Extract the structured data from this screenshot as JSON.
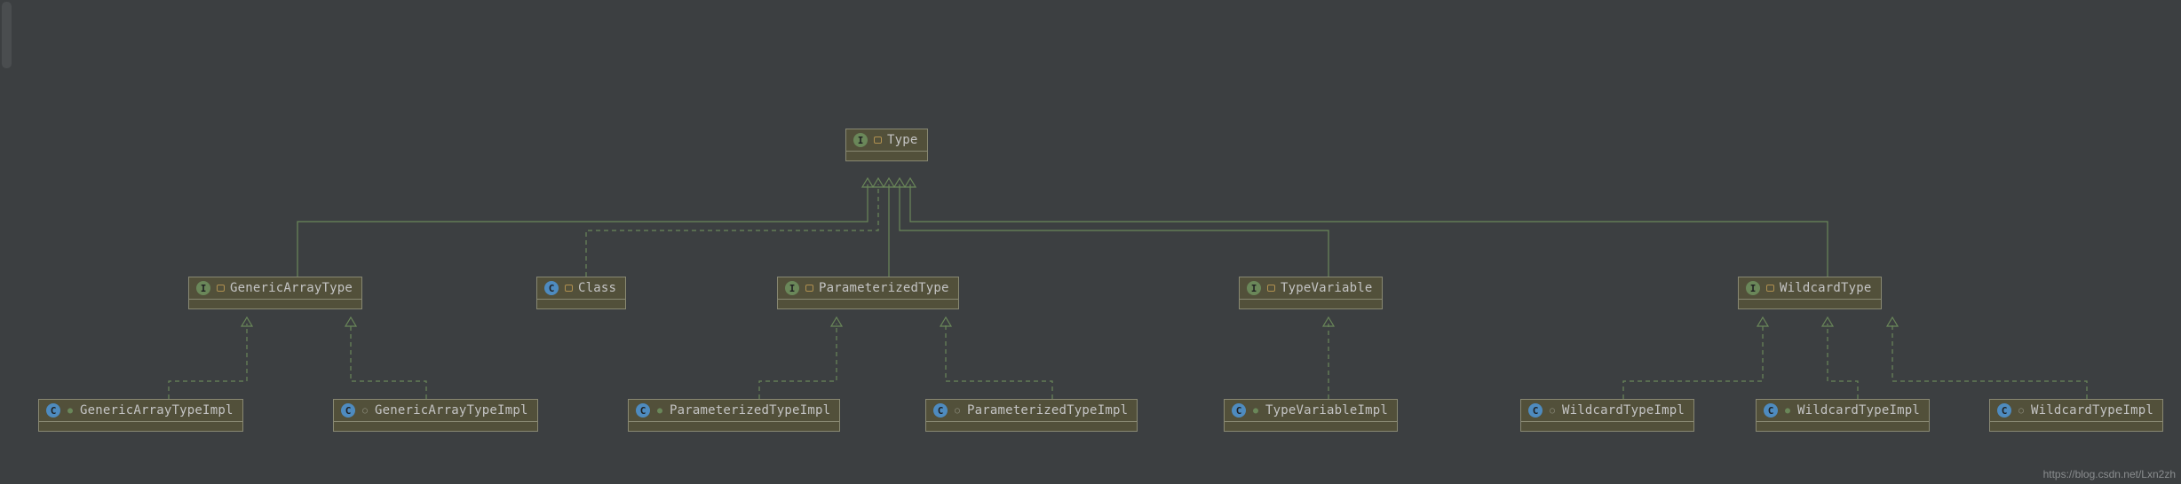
{
  "watermark": "https://blog.csdn.net/Lxn2zh",
  "nodes": {
    "type": {
      "name": "Type",
      "kind": "interface",
      "vis": "public"
    },
    "genericArrayType": {
      "name": "GenericArrayType",
      "kind": "interface",
      "vis": "public"
    },
    "classNode": {
      "name": "Class",
      "kind": "class",
      "vis": "public"
    },
    "parameterizedType": {
      "name": "ParameterizedType",
      "kind": "interface",
      "vis": "public"
    },
    "typeVariable": {
      "name": "TypeVariable",
      "kind": "interface",
      "vis": "public"
    },
    "wildcardType": {
      "name": "WildcardType",
      "kind": "interface",
      "vis": "public"
    },
    "genericArrayTypeImpl1": {
      "name": "GenericArrayTypeImpl",
      "kind": "class",
      "vis": "public"
    },
    "genericArrayTypeImpl2": {
      "name": "GenericArrayTypeImpl",
      "kind": "class",
      "vis": "default"
    },
    "parameterizedTypeImpl1": {
      "name": "ParameterizedTypeImpl",
      "kind": "class",
      "vis": "public"
    },
    "parameterizedTypeImpl2": {
      "name": "ParameterizedTypeImpl",
      "kind": "class",
      "vis": "default"
    },
    "typeVariableImpl": {
      "name": "TypeVariableImpl",
      "kind": "class",
      "vis": "public"
    },
    "wildcardTypeImpl1": {
      "name": "WildcardTypeImpl",
      "kind": "class",
      "vis": "default"
    },
    "wildcardTypeImpl2": {
      "name": "WildcardTypeImpl",
      "kind": "class",
      "vis": "public"
    },
    "wildcardTypeImpl3": {
      "name": "WildcardTypeImpl",
      "kind": "class",
      "vis": "default"
    }
  },
  "chart_data": {
    "type": "uml-class-hierarchy",
    "title": "Java Type hierarchy",
    "nodes": [
      {
        "id": "Type",
        "stereotype": "interface"
      },
      {
        "id": "GenericArrayType",
        "stereotype": "interface"
      },
      {
        "id": "Class",
        "stereotype": "class"
      },
      {
        "id": "ParameterizedType",
        "stereotype": "interface"
      },
      {
        "id": "TypeVariable",
        "stereotype": "interface"
      },
      {
        "id": "WildcardType",
        "stereotype": "interface"
      },
      {
        "id": "GenericArrayTypeImpl_1",
        "stereotype": "class"
      },
      {
        "id": "GenericArrayTypeImpl_2",
        "stereotype": "class"
      },
      {
        "id": "ParameterizedTypeImpl_1",
        "stereotype": "class"
      },
      {
        "id": "ParameterizedTypeImpl_2",
        "stereotype": "class"
      },
      {
        "id": "TypeVariableImpl",
        "stereotype": "class"
      },
      {
        "id": "WildcardTypeImpl_1",
        "stereotype": "class"
      },
      {
        "id": "WildcardTypeImpl_2",
        "stereotype": "class"
      },
      {
        "id": "WildcardTypeImpl_3",
        "stereotype": "class"
      }
    ],
    "edges": [
      {
        "from": "GenericArrayType",
        "to": "Type",
        "relation": "extends",
        "style": "solid"
      },
      {
        "from": "Class",
        "to": "Type",
        "relation": "implements",
        "style": "dashed"
      },
      {
        "from": "ParameterizedType",
        "to": "Type",
        "relation": "extends",
        "style": "solid"
      },
      {
        "from": "TypeVariable",
        "to": "Type",
        "relation": "extends",
        "style": "solid"
      },
      {
        "from": "WildcardType",
        "to": "Type",
        "relation": "extends",
        "style": "solid"
      },
      {
        "from": "GenericArrayTypeImpl_1",
        "to": "GenericArrayType",
        "relation": "implements",
        "style": "dashed"
      },
      {
        "from": "GenericArrayTypeImpl_2",
        "to": "GenericArrayType",
        "relation": "implements",
        "style": "dashed"
      },
      {
        "from": "ParameterizedTypeImpl_1",
        "to": "ParameterizedType",
        "relation": "implements",
        "style": "dashed"
      },
      {
        "from": "ParameterizedTypeImpl_2",
        "to": "ParameterizedType",
        "relation": "implements",
        "style": "dashed"
      },
      {
        "from": "TypeVariableImpl",
        "to": "TypeVariable",
        "relation": "implements",
        "style": "dashed"
      },
      {
        "from": "WildcardTypeImpl_1",
        "to": "WildcardType",
        "relation": "implements",
        "style": "dashed"
      },
      {
        "from": "WildcardTypeImpl_2",
        "to": "WildcardType",
        "relation": "implements",
        "style": "dashed"
      },
      {
        "from": "WildcardTypeImpl_3",
        "to": "WildcardType",
        "relation": "implements",
        "style": "dashed"
      }
    ]
  }
}
